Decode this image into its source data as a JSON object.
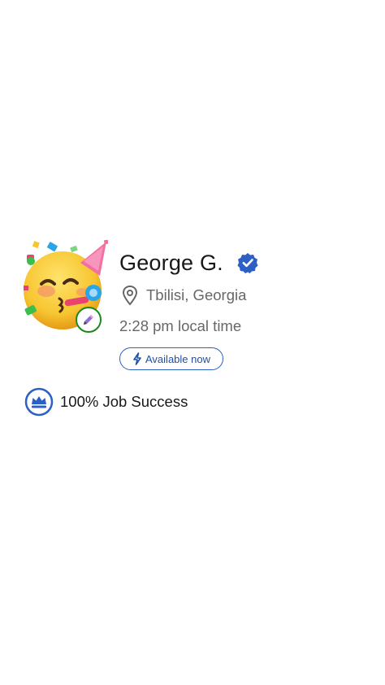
{
  "profile": {
    "name": "George G.",
    "location": "Tbilisi, Georgia",
    "local_time": "2:28 pm local time",
    "availability_label": "Available now",
    "job_success": "100% Job Success"
  },
  "icons": {
    "avatar": "party-face-emoji",
    "edit": "pencil-icon",
    "verified": "verified-check-icon",
    "location": "map-pin-icon",
    "availability": "lightning-icon",
    "job_success": "crown-badge-icon"
  },
  "colors": {
    "accent_blue": "#2d60c4",
    "edit_badge_border": "#1a8a1a",
    "secondary_text": "#676767"
  }
}
